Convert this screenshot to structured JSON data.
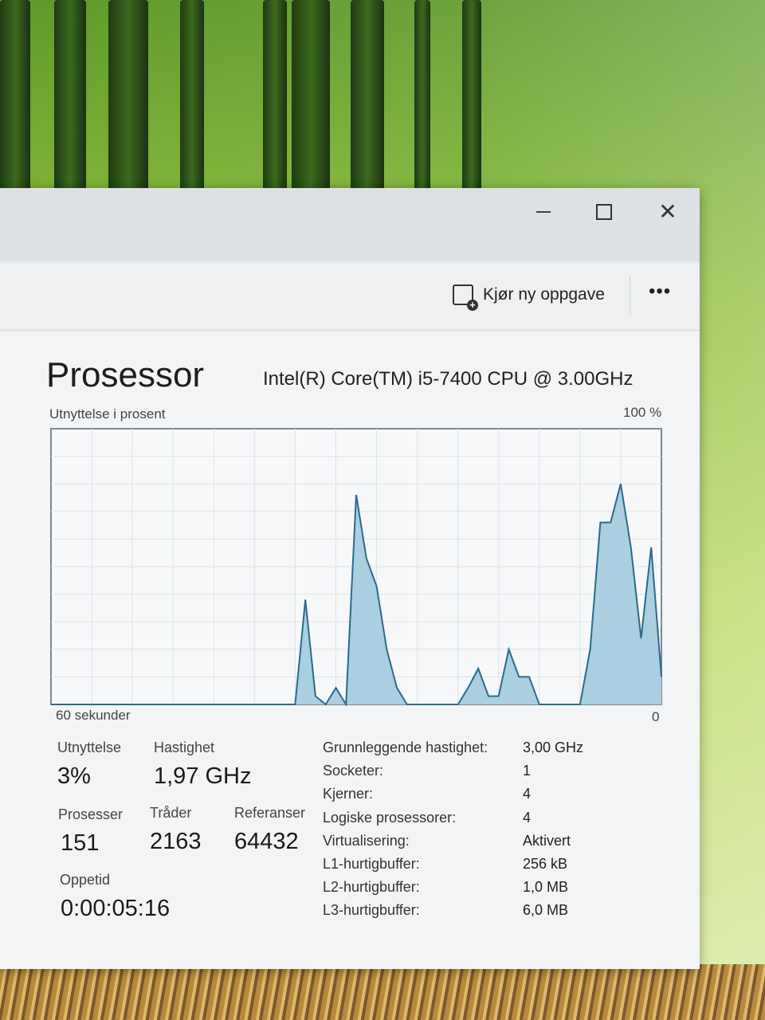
{
  "toolbar": {
    "run_new_task_label": "Kjør ny oppgave",
    "more_label": "•••"
  },
  "page": {
    "title": "Prosessor",
    "cpu_model": "Intel(R) Core(TM) i5-7400 CPU @ 3.00GHz"
  },
  "graph": {
    "label": "Utnyttelse i prosent",
    "max_label": "100 %",
    "time_label": "60 sekunder",
    "min_label": "0",
    "fill_color": "#a9cfe0",
    "line_color": "#2c6a8e"
  },
  "chart_data": {
    "type": "area",
    "ylim": [
      0,
      100
    ],
    "x": [
      0,
      1,
      2,
      3,
      4,
      5,
      6,
      7,
      8,
      9,
      10,
      11,
      12,
      13,
      14,
      15,
      16,
      17,
      18,
      19,
      20,
      21,
      22,
      23,
      24,
      25,
      26,
      27,
      28,
      29,
      30,
      31,
      32,
      33,
      34,
      35,
      36,
      37,
      38,
      39,
      40,
      41,
      42,
      43,
      44,
      45,
      46,
      47,
      48,
      49,
      50,
      51,
      52,
      53,
      54,
      55,
      56,
      57,
      58,
      59,
      60
    ],
    "values": [
      0,
      0,
      0,
      0,
      0,
      0,
      0,
      0,
      0,
      0,
      0,
      0,
      0,
      0,
      0,
      0,
      0,
      0,
      0,
      0,
      0,
      0,
      0,
      0,
      0,
      38,
      3,
      0,
      6,
      0,
      76,
      53,
      43,
      20,
      6,
      0,
      0,
      0,
      0,
      0,
      0,
      6,
      13,
      3,
      3,
      20,
      10,
      10,
      0,
      0,
      0,
      0,
      0,
      20,
      66,
      66,
      80,
      57,
      24,
      57,
      10
    ]
  },
  "stats": {
    "utilization_label": "Utnyttelse",
    "utilization_value": "3%",
    "speed_label": "Hastighet",
    "speed_value": "1,97 GHz",
    "processes_label": "Prosesser",
    "processes_value": "151",
    "threads_label": "Tråder",
    "threads_value": "2163",
    "handles_label": "Referanser",
    "handles_value": "64432",
    "uptime_label": "Oppetid",
    "uptime_value": "0:00:05:16"
  },
  "specs": [
    {
      "label": "Grunnleggende hastighet:",
      "value": "3,00 GHz"
    },
    {
      "label": "Socketer:",
      "value": "1"
    },
    {
      "label": "Kjerner:",
      "value": "4"
    },
    {
      "label": "Logiske prosessorer:",
      "value": "4"
    },
    {
      "label": "Virtualisering:",
      "value": "Aktivert"
    },
    {
      "label": "L1-hurtigbuffer:",
      "value": "256 kB"
    },
    {
      "label": "L2-hurtigbuffer:",
      "value": "1,0 MB"
    },
    {
      "label": "L3-hurtigbuffer:",
      "value": "6,0 MB"
    }
  ]
}
